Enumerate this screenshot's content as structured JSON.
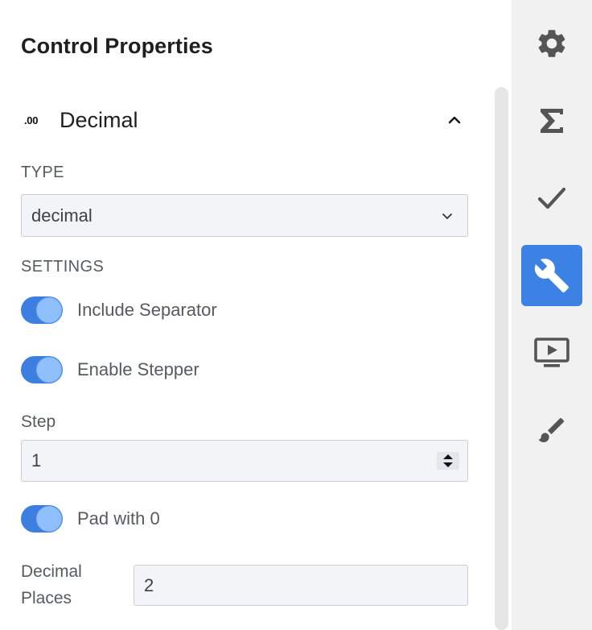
{
  "panel": {
    "title": "Control Properties"
  },
  "section": {
    "badge": ".00",
    "title": "Decimal",
    "chevron_icon": "chevron-up-icon"
  },
  "type_field": {
    "label": "TYPE",
    "value": "decimal"
  },
  "settings": {
    "label": "SETTINGS",
    "toggles": [
      {
        "label": "Include Separator",
        "on": true
      },
      {
        "label": "Enable Stepper",
        "on": true
      },
      {
        "label": "Pad with 0",
        "on": true
      }
    ]
  },
  "step_field": {
    "label": "Step",
    "value": "1"
  },
  "decimal_places": {
    "label_line1": "Decimal",
    "label_line2": "Places",
    "value": "2"
  },
  "sidebar": {
    "items": [
      {
        "icon": "gear-icon",
        "active": false
      },
      {
        "icon": "sigma-icon",
        "active": false
      },
      {
        "icon": "checkmark-icon",
        "active": false
      },
      {
        "icon": "wrench-icon",
        "active": true
      },
      {
        "icon": "preview-icon",
        "active": false
      },
      {
        "icon": "brush-icon",
        "active": false
      }
    ]
  },
  "colors": {
    "accent": "#3b82e4",
    "toggle_on": "#3d7fe0",
    "sidebar_bg": "#f1f1f1",
    "field_bg": "#f2f4f7"
  }
}
